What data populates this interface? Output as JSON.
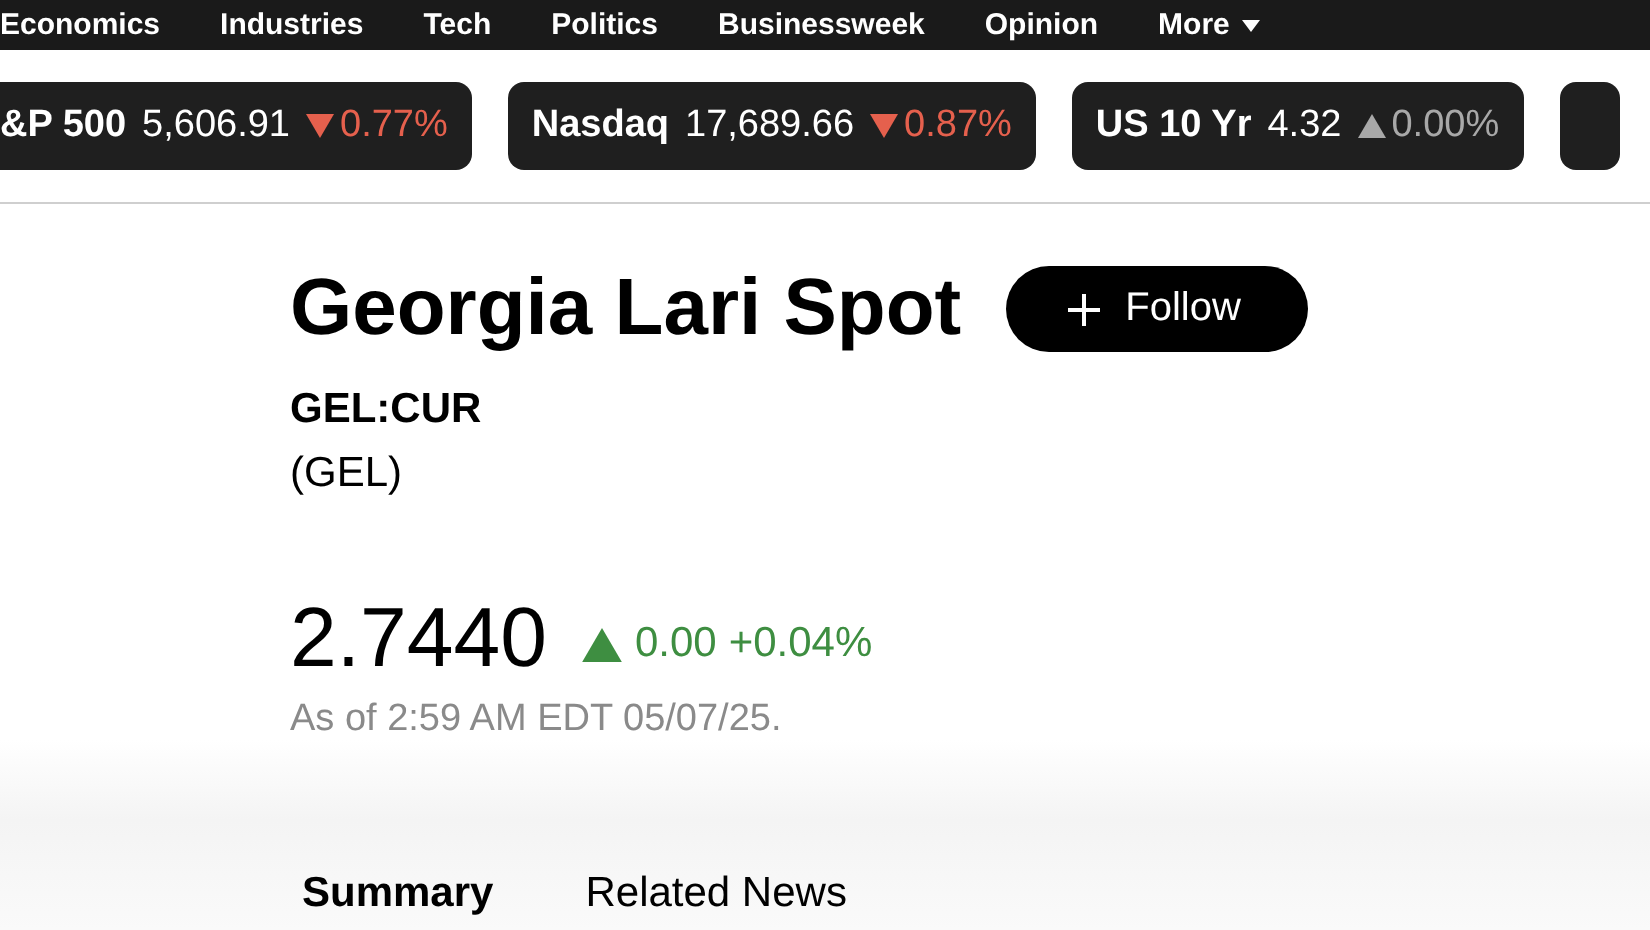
{
  "nav": {
    "items": [
      "Economics",
      "Industries",
      "Tech",
      "Politics",
      "Businessweek",
      "Opinion",
      "More"
    ]
  },
  "tickers": [
    {
      "name": "&P 500",
      "value": "5,606.91",
      "change": "0.77%",
      "kind": "down"
    },
    {
      "name": "Nasdaq",
      "value": "17,689.66",
      "change": "0.87%",
      "kind": "down"
    },
    {
      "name": "US 10 Yr",
      "value": "4.32",
      "change": "0.00%",
      "kind": "flat"
    }
  ],
  "quote": {
    "title": "Georgia Lari Spot",
    "follow_button": "Follow",
    "ticker": "GEL:CUR",
    "currency": "(GEL)",
    "price": "2.7440",
    "change": "0.00",
    "change_percent": "+0.04%",
    "kind": "up",
    "as_of": "As of 2:59 AM EDT 05/07/25."
  },
  "tabs": [
    {
      "label": "Summary",
      "selected": true
    },
    {
      "label": "Related News",
      "selected": false
    }
  ]
}
